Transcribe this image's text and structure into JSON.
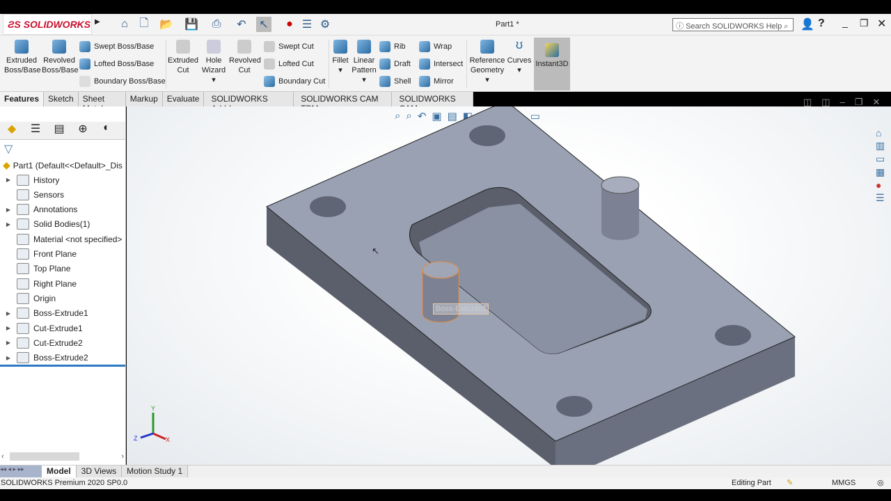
{
  "window": {
    "title": "Part1 *",
    "search_placeholder": "Search SOLIDWORKS Help",
    "logo": "SOLIDWORKS"
  },
  "ribbon": {
    "extruded_boss": "Extruded Boss/Base",
    "revolved_boss": "Revolved Boss/Base",
    "swept_boss": "Swept Boss/Base",
    "lofted_boss": "Lofted Boss/Base",
    "boundary_boss": "Boundary Boss/Base",
    "extruded_cut": "Extruded Cut",
    "hole_wizard": "Hole Wizard",
    "revolved_cut": "Revolved Cut",
    "swept_cut": "Swept Cut",
    "lofted_cut": "Lofted Cut",
    "boundary_cut": "Boundary Cut",
    "fillet": "Fillet",
    "linear_pattern": "Linear Pattern",
    "rib": "Rib",
    "wrap": "Wrap",
    "draft": "Draft",
    "intersect": "Intersect",
    "shell": "Shell",
    "mirror": "Mirror",
    "reference_geometry": "Reference Geometry",
    "curves": "Curves",
    "instant3d": "Instant3D"
  },
  "tabs": [
    "Features",
    "Sketch",
    "Sheet Metal",
    "Markup",
    "Evaluate",
    "SOLIDWORKS Add-Ins",
    "SOLIDWORKS CAM TBM",
    "SOLIDWORKS CAM"
  ],
  "tree": {
    "root": "Part1  (Default<<Default>_Dis",
    "items": [
      "History",
      "Sensors",
      "Annotations",
      "Solid Bodies(1)",
      "Material <not specified>",
      "Front Plane",
      "Top Plane",
      "Right Plane",
      "Origin",
      "Boss-Extrude1",
      "Cut-Extrude1",
      "Cut-Extrude2",
      "Boss-Extrude2"
    ]
  },
  "viewport": {
    "tooltip": "Boss-Extrude2",
    "axes": {
      "x": "X",
      "y": "Y",
      "z": "Z"
    },
    "colors": {
      "top": "#9aa1b3",
      "side": "#5a5f6b",
      "highlight": "#e08a3c"
    }
  },
  "bottom_tabs": [
    "Model",
    "3D Views",
    "Motion Study 1"
  ],
  "status": {
    "version": "SOLIDWORKS Premium 2020 SP0.0",
    "mode": "Editing Part",
    "units": "MMGS"
  }
}
